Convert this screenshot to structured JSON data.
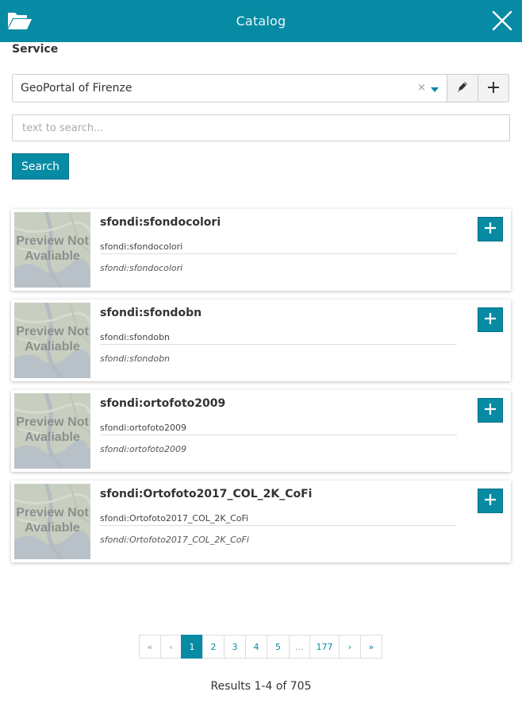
{
  "header": {
    "title": "Catalog"
  },
  "service": {
    "label": "Service",
    "selected": "GeoPortal of Firenze",
    "clear_glyph": "×"
  },
  "search": {
    "placeholder": "text to search...",
    "button_label": "Search"
  },
  "results": [
    {
      "title": "sfondi:sfondocolori",
      "name": "sfondi:sfondocolori",
      "description": "sfondi:sfondocolori",
      "thumbnail_text": [
        "Preview Not",
        "Avaliable"
      ]
    },
    {
      "title": "sfondi:sfondobn",
      "name": "sfondi:sfondobn",
      "description": "sfondi:sfondobn",
      "thumbnail_text": [
        "Preview Not",
        "Avaliable"
      ]
    },
    {
      "title": "sfondi:ortofoto2009",
      "name": "sfondi:ortofoto2009",
      "description": "sfondi:ortofoto2009",
      "thumbnail_text": [
        "Preview Not",
        "Avaliable"
      ]
    },
    {
      "title": "sfondi:Ortofoto2017_COL_2K_CoFi",
      "name": "sfondi:Ortofoto2017_COL_2K_CoFi",
      "description": "sfondi:Ortofoto2017_COL_2K_CoFi",
      "thumbnail_text": [
        "Preview Not",
        "Avaliable"
      ]
    }
  ],
  "pagination": {
    "pages": [
      {
        "label": "«",
        "kind": "muted"
      },
      {
        "label": "‹",
        "kind": "muted"
      },
      {
        "label": "1",
        "kind": "active"
      },
      {
        "label": "2",
        "kind": "page"
      },
      {
        "label": "3",
        "kind": "page"
      },
      {
        "label": "4",
        "kind": "page"
      },
      {
        "label": "5",
        "kind": "page"
      },
      {
        "label": "...",
        "kind": "muted"
      },
      {
        "label": "177",
        "kind": "page"
      },
      {
        "label": "›",
        "kind": "page"
      },
      {
        "label": "»",
        "kind": "page"
      }
    ]
  },
  "footer": {
    "results_text": "Results 1-4 of 705"
  },
  "icons": {
    "header_left": "folder-open-icon",
    "header_right": "close-icon",
    "service_edit": "pencil-icon",
    "service_add": "plus-icon",
    "result_add": "plus-icon"
  },
  "colors": {
    "accent": "#078aa3",
    "white": "#ffffff",
    "text": "#333333"
  }
}
